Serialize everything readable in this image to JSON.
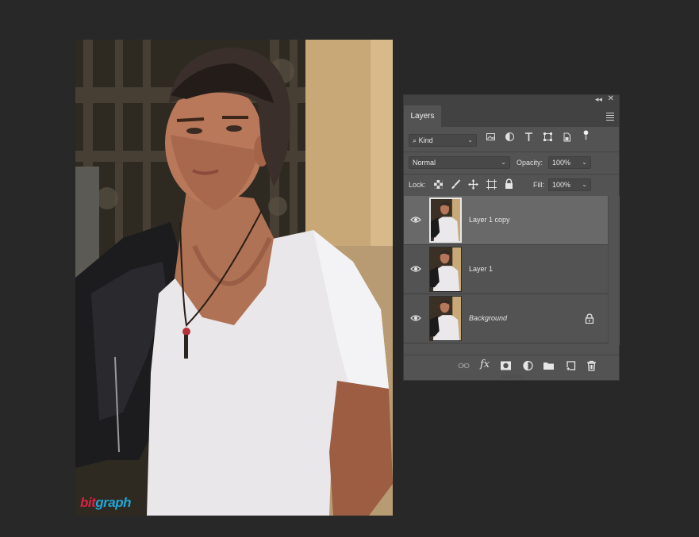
{
  "watermark": {
    "part1": "bit",
    "part2": "graph"
  },
  "panel": {
    "tab_label": "Layers",
    "filter": {
      "kind_label": "Kind"
    },
    "blend_mode": "Normal",
    "opacity_label": "Opacity:",
    "opacity_value": "100%",
    "lock_label": "Lock:",
    "fill_label": "Fill:",
    "fill_value": "100%",
    "layers": [
      {
        "name": "Layer 1 copy",
        "selected": true,
        "italic": false,
        "locked": false
      },
      {
        "name": "Layer 1",
        "selected": false,
        "italic": false,
        "locked": false
      },
      {
        "name": "Background",
        "selected": false,
        "italic": true,
        "locked": true
      }
    ],
    "bottom_icons": [
      "link-icon",
      "fx-icon",
      "mask-icon",
      "adjustment-icon",
      "folder-icon",
      "new-layer-icon",
      "trash-icon"
    ],
    "fx_label": "fx"
  },
  "colors": {
    "app_bg": "#282828",
    "panel_bg": "#535353",
    "selected_row": "#696969",
    "watermark_red": "#d8233f",
    "watermark_blue": "#1fa6d6"
  }
}
